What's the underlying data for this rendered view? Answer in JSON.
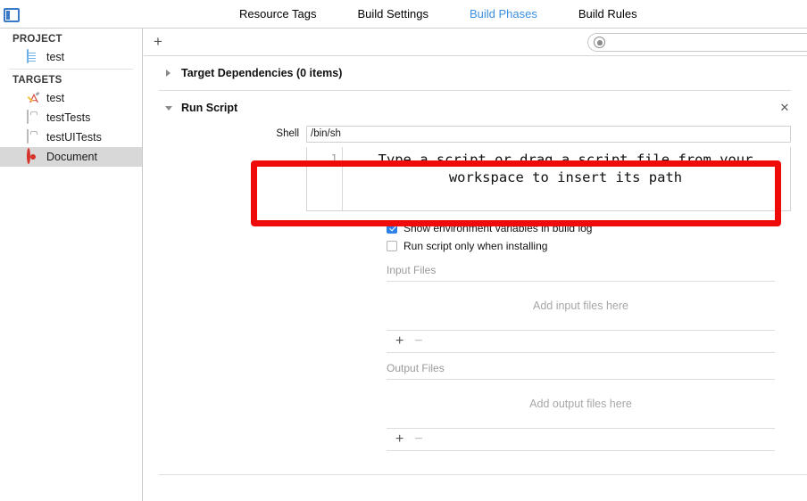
{
  "window": {
    "panel_toggle_icon": "left-panel-toggle-icon"
  },
  "tabs": [
    {
      "label": "Resource Tags",
      "active": false
    },
    {
      "label": "Build Settings",
      "active": false
    },
    {
      "label": "Build Phases",
      "active": true
    },
    {
      "label": "Build Rules",
      "active": false
    }
  ],
  "sidebar": {
    "project_group_label": "PROJECT",
    "targets_group_label": "TARGETS",
    "project_items": [
      {
        "label": "test",
        "icon": "project-document-icon"
      }
    ],
    "target_items": [
      {
        "label": "test",
        "icon": "app-target-icon",
        "selected": false
      },
      {
        "label": "testTests",
        "icon": "test-bundle-icon",
        "selected": false
      },
      {
        "label": "testUITests",
        "icon": "test-bundle-icon",
        "selected": false
      },
      {
        "label": "Document",
        "icon": "bullseye-target-icon",
        "selected": true
      }
    ]
  },
  "toolbar": {
    "add_phase_label": "+",
    "filter_placeholder": "",
    "filter_value": "",
    "filter_icon": "filter-circle-icon"
  },
  "phases": [
    {
      "title": "Target Dependencies (0 items)",
      "expanded": false,
      "disclosure_icon": "chevron-right-icon"
    },
    {
      "title": "Run Script",
      "expanded": true,
      "disclosure_icon": "chevron-down-icon",
      "close_label": "✕"
    }
  ],
  "run_script": {
    "shell_label": "Shell",
    "shell_value": "/bin/sh",
    "editor_line_number": "1",
    "editor_placeholder": "Type a script or drag a script file from your\nworkspace to insert its path",
    "options": [
      {
        "label": "Show environment variables in build log",
        "checked": true
      },
      {
        "label": "Run script only when installing",
        "checked": false
      }
    ],
    "input_files": {
      "header": "Input Files",
      "empty_text": "Add input files here",
      "add_label": "+",
      "remove_label": "−"
    },
    "output_files": {
      "header": "Output Files",
      "empty_text": "Add output files here",
      "add_label": "+",
      "remove_label": "−"
    }
  },
  "annotation": {
    "highlight_color": "#f00b0b"
  }
}
